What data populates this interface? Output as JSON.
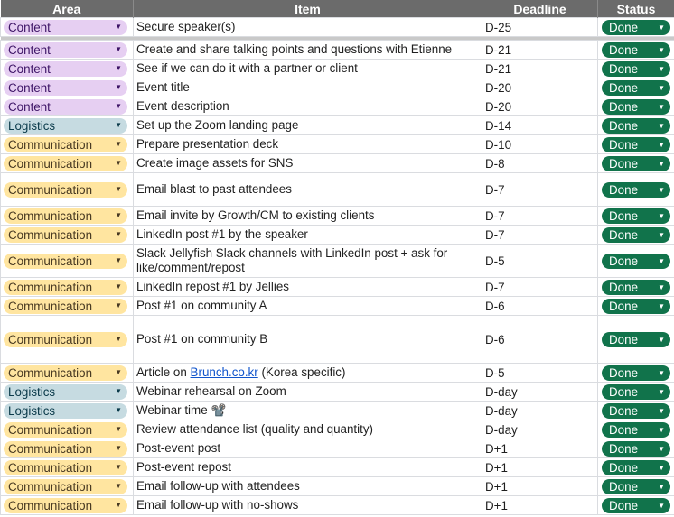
{
  "headers": {
    "area": "Area",
    "item": "Item",
    "deadline": "Deadline",
    "status": "Status"
  },
  "colors": {
    "content": "#e6cff2",
    "logistics": "#c6dbe1",
    "communication": "#ffe5a0",
    "done": "#11734b",
    "header": "#6b6b6b"
  },
  "icons": {
    "dropdown": "caret-down-icon",
    "camera": "film-camera-emoji"
  },
  "rows": [
    {
      "area": "Content",
      "item": "Secure speaker(s)",
      "deadline": "D-25",
      "status": "Done",
      "type": "content"
    },
    {
      "area": "Content",
      "item": "Create and share talking points and questions with Etienne",
      "deadline": "D-21",
      "status": "Done",
      "type": "content"
    },
    {
      "area": "Content",
      "item": "See if we can do it with a partner or client",
      "deadline": "D-21",
      "status": "Done",
      "type": "content"
    },
    {
      "area": "Content",
      "item": "Event title",
      "deadline": "D-20",
      "status": "Done",
      "type": "content"
    },
    {
      "area": "Content",
      "item": "Event description",
      "deadline": "D-20",
      "status": "Done",
      "type": "content"
    },
    {
      "area": "Logistics",
      "item": "Set up the Zoom landing page",
      "deadline": "D-14",
      "status": "Done",
      "type": "logistics"
    },
    {
      "area": "Communication",
      "item": "Prepare presentation deck",
      "deadline": "D-10",
      "status": "Done",
      "type": "communication"
    },
    {
      "area": "Communication",
      "item": "Create image assets for SNS",
      "deadline": "D-8",
      "status": "Done",
      "type": "communication"
    },
    {
      "area": "Communication",
      "item": "Email blast to past attendees",
      "deadline": "D-7",
      "status": "Done",
      "type": "communication"
    },
    {
      "area": "Communication",
      "item": "Email invite by Growth/CM to existing clients",
      "deadline": "D-7",
      "status": "Done",
      "type": "communication"
    },
    {
      "area": "Communication",
      "item": "LinkedIn post #1 by the speaker",
      "deadline": "D-7",
      "status": "Done",
      "type": "communication"
    },
    {
      "area": "Communication",
      "item": "Slack Jellyfish Slack channels with LinkedIn post + ask for like/comment/repost",
      "deadline": "D-5",
      "status": "Done",
      "type": "communication"
    },
    {
      "area": "Communication",
      "item": "LinkedIn repost #1 by Jellies",
      "deadline": "D-7",
      "status": "Done",
      "type": "communication"
    },
    {
      "area": "Communication",
      "item": "Post #1 on community A",
      "deadline": "D-6",
      "status": "Done",
      "type": "communication"
    },
    {
      "area": "Communication",
      "item": "Post #1 on community B",
      "deadline": "D-6",
      "status": "Done",
      "type": "communication"
    },
    {
      "area": "Communication",
      "item_pre": "Article on ",
      "item_link": "Brunch.co.kr",
      "item_post": " (Korea specific)",
      "deadline": "D-5",
      "status": "Done",
      "type": "communication"
    },
    {
      "area": "Logistics",
      "item": "Webinar rehearsal on Zoom",
      "deadline": "D-day",
      "status": "Done",
      "type": "logistics"
    },
    {
      "area": "Logistics",
      "item": "Webinar time",
      "item_emoji": "📽️",
      "deadline": "D-day",
      "status": "Done",
      "type": "logistics"
    },
    {
      "area": "Communication",
      "item": "Review attendance list (quality and quantity)",
      "deadline": "D-day",
      "status": "Done",
      "type": "communication"
    },
    {
      "area": "Communication",
      "item": "Post-event post",
      "deadline": "D+1",
      "status": "Done",
      "type": "communication"
    },
    {
      "area": "Communication",
      "item": "Post-event repost",
      "deadline": "D+1",
      "status": "Done",
      "type": "communication"
    },
    {
      "area": "Communication",
      "item": "Email follow-up with attendees",
      "deadline": "D+1",
      "status": "Done",
      "type": "communication"
    },
    {
      "area": "Communication",
      "item": "Email follow-up with no-shows",
      "deadline": "D+1",
      "status": "Done",
      "type": "communication"
    }
  ]
}
